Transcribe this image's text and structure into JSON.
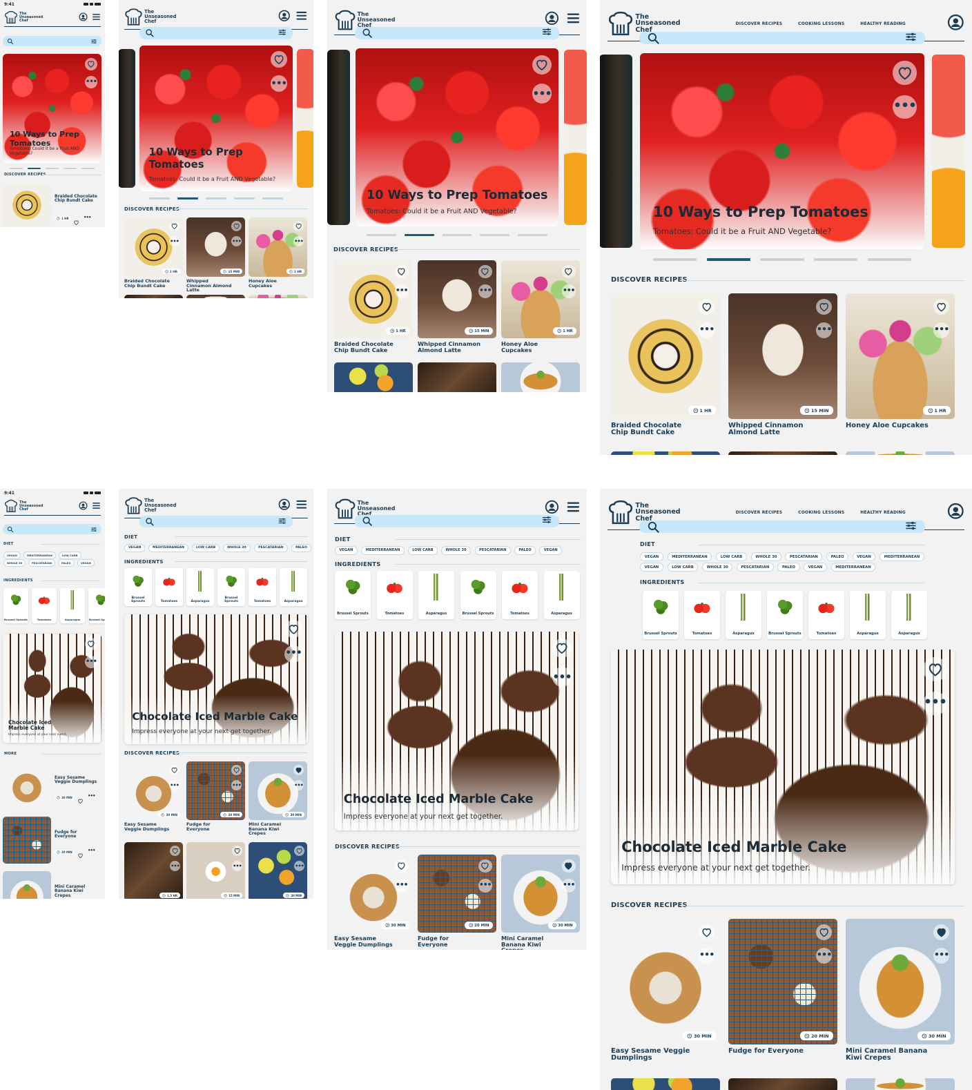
{
  "brand": {
    "name_line1": "The",
    "name_line2": "Unseasoned",
    "name_line3": "Chef"
  },
  "status": {
    "time": "9:41"
  },
  "nav": {
    "discover": "DISCOVER RECIPES",
    "lessons": "COOKING LESSONS",
    "reading": "HEALTHY READING"
  },
  "hero_top": {
    "title": "10 Ways to Prep Tomatoes",
    "subtitle": "Tomatoes: Could it be a Fruit AND Vegetable?",
    "active_slide": 2,
    "slide_count": 5
  },
  "hero_bottom": {
    "title": "Chocolate Iced Marble Cake",
    "title_small": "Chocolate Iced Marble Cake",
    "subtitle": "Impress everyone at your next get together.",
    "subtitle_small": "Impress everyone at your next event."
  },
  "sections": {
    "discover": "DISCOVER RECIPES",
    "diet": "DIET",
    "ingredients": "INGREDIENTS",
    "more": "MORE"
  },
  "recipes_top": [
    {
      "title": "Braided Chocolate Chip Bundt Cake",
      "time": "1 HR",
      "favorite": false
    },
    {
      "title": "Whipped Cinnamon Almond Latte",
      "time": "15 MIN",
      "favorite": false
    },
    {
      "title": "Honey Aloe Cupcakes",
      "time": "1 HR",
      "favorite": false
    }
  ],
  "recipes_bottom": [
    {
      "title": "Easy Sesame Veggie Dumplings",
      "time": "30 MIN",
      "favorite": false
    },
    {
      "title": "Fudge for Everyone",
      "time": "20 MIN",
      "favorite": false
    },
    {
      "title": "Mini Caramel Banana Kiwi Crepes",
      "time": "30 MIN",
      "favorite": true
    }
  ],
  "recipes_extra_times": [
    "1.5 HR",
    "15 MIN",
    "30 MIN"
  ],
  "diet_chips": [
    "VEGAN",
    "MEDITERRANEAN",
    "LOW CARB",
    "WHOLE 30",
    "PESCATARIAN",
    "PALEO",
    "VEGAN",
    "MEDITERRANEAN",
    "VEGAN",
    "LOW CARB",
    "WHOLE 30",
    "PESCATARIAN",
    "PALEO",
    "VEGAN",
    "MEDITERRANEAN"
  ],
  "ingredients": [
    {
      "label": "Brussel Sprouts",
      "kind": "broc"
    },
    {
      "label": "Tomatoes",
      "kind": "tomicon"
    },
    {
      "label": "Asparagus",
      "kind": "aspar"
    },
    {
      "label": "Brussel Sprouts",
      "kind": "broc"
    },
    {
      "label": "Tomatoes",
      "kind": "tomicon"
    },
    {
      "label": "Asparagus",
      "kind": "aspar"
    },
    {
      "label": "Asparagus",
      "kind": "aspar"
    }
  ],
  "colors": {
    "navy": "#1c3d57",
    "search_bg": "#c6e8fa",
    "bg": "#f2f2f2"
  }
}
